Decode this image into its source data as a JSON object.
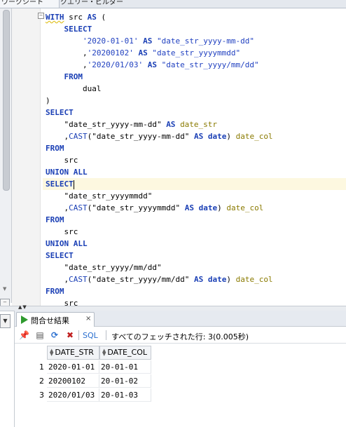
{
  "top_tabs": [
    "ワークシート",
    "クエリー・ビルダー"
  ],
  "editor": {
    "lines": [
      [
        {
          "t": "WITH",
          "c": "kw squiggle"
        },
        {
          "t": " src "
        },
        {
          "t": "AS",
          "c": "kw"
        },
        {
          "t": " ("
        }
      ],
      [
        {
          "t": "    "
        },
        {
          "t": "SELECT",
          "c": "kw"
        }
      ],
      [
        {
          "t": "        "
        },
        {
          "t": "'2020-01-01'",
          "c": "str"
        },
        {
          "t": " "
        },
        {
          "t": "AS",
          "c": "kw"
        },
        {
          "t": " "
        },
        {
          "t": "\"date_str_yyyy-mm-dd\"",
          "c": "str"
        }
      ],
      [
        {
          "t": "        ,"
        },
        {
          "t": "'20200102'",
          "c": "str"
        },
        {
          "t": " "
        },
        {
          "t": "AS",
          "c": "kw"
        },
        {
          "t": " "
        },
        {
          "t": "\"date_str_yyyymmdd\"",
          "c": "str"
        }
      ],
      [
        {
          "t": "        ,"
        },
        {
          "t": "'2020/01/03'",
          "c": "str"
        },
        {
          "t": " "
        },
        {
          "t": "AS",
          "c": "kw"
        },
        {
          "t": " "
        },
        {
          "t": "\"date_str_yyyy/mm/dd\"",
          "c": "str"
        }
      ],
      [
        {
          "t": "    "
        },
        {
          "t": "FROM",
          "c": "kw"
        }
      ],
      [
        {
          "t": "        dual"
        }
      ],
      [
        {
          "t": ")"
        }
      ],
      [
        {
          "t": "SELECT",
          "c": "kw"
        }
      ],
      [
        {
          "t": "    \"date_str_yyyy-mm-dd\" "
        },
        {
          "t": "AS",
          "c": "kw"
        },
        {
          "t": " "
        },
        {
          "t": "date_str",
          "c": "col"
        }
      ],
      [
        {
          "t": "    ,"
        },
        {
          "t": "CAST",
          "c": "kwfn"
        },
        {
          "t": "(\"date_str_yyyy-mm-dd\" "
        },
        {
          "t": "AS",
          "c": "kw"
        },
        {
          "t": " "
        },
        {
          "t": "date",
          "c": "kw"
        },
        {
          "t": ") "
        },
        {
          "t": "date_col",
          "c": "col"
        }
      ],
      [
        {
          "t": "FROM",
          "c": "kw"
        }
      ],
      [
        {
          "t": "    src"
        }
      ],
      [
        {
          "t": "UNION ALL",
          "c": "kw"
        }
      ],
      [
        {
          "t": "SELECT",
          "c": "kw"
        },
        {
          "t": "|",
          "c": "caret"
        }
      ],
      [
        {
          "t": "    \"date_str_yyyymmdd\""
        }
      ],
      [
        {
          "t": "    ,"
        },
        {
          "t": "CAST",
          "c": "kwfn"
        },
        {
          "t": "(\"date_str_yyyymmdd\" "
        },
        {
          "t": "AS",
          "c": "kw"
        },
        {
          "t": " "
        },
        {
          "t": "date",
          "c": "kw"
        },
        {
          "t": ") "
        },
        {
          "t": "date_col",
          "c": "col"
        }
      ],
      [
        {
          "t": "FROM",
          "c": "kw"
        }
      ],
      [
        {
          "t": "    src"
        }
      ],
      [
        {
          "t": "UNION ALL",
          "c": "kw"
        }
      ],
      [
        {
          "t": "SELECT",
          "c": "kw"
        }
      ],
      [
        {
          "t": "    \"date_str_yyyy/mm/dd\""
        }
      ],
      [
        {
          "t": "    ,"
        },
        {
          "t": "CAST",
          "c": "kwfn"
        },
        {
          "t": "(\"date_str_yyyy/mm/dd\" "
        },
        {
          "t": "AS",
          "c": "kw"
        },
        {
          "t": " "
        },
        {
          "t": "date",
          "c": "kw"
        },
        {
          "t": ") "
        },
        {
          "t": "date_col",
          "c": "col"
        }
      ],
      [
        {
          "t": "FROM",
          "c": "kw"
        }
      ],
      [
        {
          "t": "    src"
        }
      ]
    ],
    "current_line": 14
  },
  "result": {
    "tab_label": "問合せ結果",
    "tab_close": "×",
    "sql_link": "SQL",
    "status": "すべてのフェッチされた行: 3(0.005秒)",
    "columns": [
      "DATE_STR",
      "DATE_COL"
    ],
    "rows": [
      {
        "num": "1",
        "cells": [
          "2020-01-01",
          "20-01-01"
        ]
      },
      {
        "num": "2",
        "cells": [
          "20200102",
          "20-01-02"
        ]
      },
      {
        "num": "3",
        "cells": [
          "2020/01/03",
          "20-01-03"
        ]
      }
    ]
  },
  "icons": {
    "pin": "pin-icon",
    "print": "print-icon",
    "refresh": "refresh-icon",
    "delete": "delete-icon",
    "play": "play-icon",
    "sort": "sort-icon"
  },
  "colors": {
    "keyword": "#1a3fb5",
    "column_alias": "#8a7a00",
    "run": "#2e9a2e"
  }
}
